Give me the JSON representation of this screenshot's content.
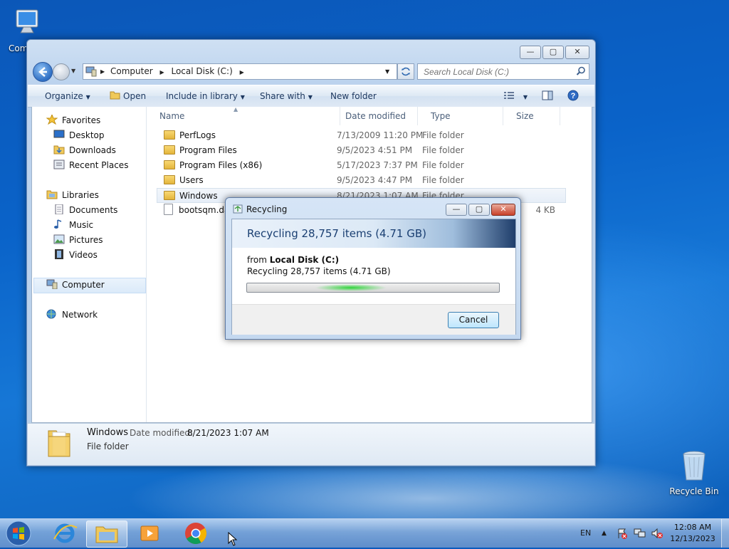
{
  "desktop": {
    "computer_label": "Com",
    "recycle_label": "Recycle Bin"
  },
  "explorer": {
    "address": {
      "segments": [
        "Computer",
        "Local Disk (C:)"
      ]
    },
    "search_placeholder": "Search Local Disk (C:)",
    "toolbar": {
      "organize": "Organize",
      "open": "Open",
      "include": "Include in library",
      "share": "Share with",
      "new_folder": "New folder"
    },
    "nav": {
      "favorites": "Favorites",
      "desktop": "Desktop",
      "downloads": "Downloads",
      "recent": "Recent Places",
      "libraries": "Libraries",
      "documents": "Documents",
      "music": "Music",
      "pictures": "Pictures",
      "videos": "Videos",
      "computer": "Computer",
      "network": "Network"
    },
    "columns": {
      "name": "Name",
      "date": "Date modified",
      "type": "Type",
      "size": "Size"
    },
    "files": [
      {
        "name": "PerfLogs",
        "date": "7/13/2009 11:20 PM",
        "type": "File folder",
        "size": ""
      },
      {
        "name": "Program Files",
        "date": "9/5/2023 4:51 PM",
        "type": "File folder",
        "size": ""
      },
      {
        "name": "Program Files (x86)",
        "date": "5/17/2023 7:37 PM",
        "type": "File folder",
        "size": ""
      },
      {
        "name": "Users",
        "date": "9/5/2023 4:47 PM",
        "type": "File folder",
        "size": ""
      },
      {
        "name": "Windows",
        "date": "8/21/2023 1:07 AM",
        "type": "File folder",
        "size": ""
      },
      {
        "name": "bootsqm.dat",
        "date": "",
        "type": "",
        "size": "4 KB"
      }
    ],
    "details": {
      "name": "Windows",
      "date_label": "Date modified:",
      "date_value": "8/21/2023 1:07 AM",
      "type": "File folder"
    }
  },
  "dialog": {
    "title": "Recycling",
    "heading": "Recycling 28,757 items (4.71 GB)",
    "from_prefix": "from",
    "from_location": "Local Disk (C:)",
    "status": "Recycling 28,757 items (4.71 GB)",
    "cancel": "Cancel"
  },
  "taskbar": {
    "lang": "EN",
    "time": "12:08 AM",
    "date": "12/13/2023"
  }
}
